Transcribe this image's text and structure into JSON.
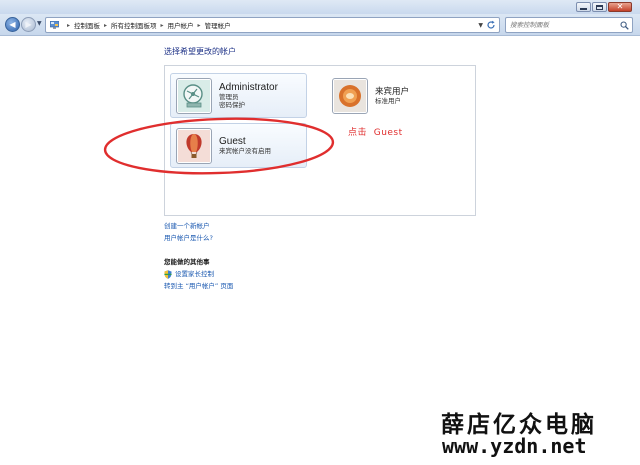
{
  "window": {
    "controls": [
      "minimize",
      "maximize",
      "close"
    ]
  },
  "toolbar": {
    "breadcrumbs": [
      "控制面板",
      "所有控制面板项",
      "用户帐户",
      "管理帐户"
    ],
    "search_placeholder": "搜索控制面板"
  },
  "main": {
    "title": "选择希望更改的帐户",
    "accounts": [
      {
        "name": "Administrator",
        "lines": [
          "管理员",
          "密码保护"
        ],
        "icon": "network-icon"
      },
      {
        "name": "来宾用户",
        "lines": [
          "标准用户"
        ],
        "icon": "orange-flower-icon"
      },
      {
        "name": "Guest",
        "lines": [
          "来宾帐户没有启用"
        ],
        "icon": "hot-air-balloon-icon"
      }
    ],
    "annotation": "点击  Guest",
    "annotation_color": "#e02e2e",
    "links": [
      "创建一个新帐户",
      "用户帐户是什么?"
    ],
    "other_section_title": "您能做的其他事",
    "other_links": [
      "设置家长控制",
      "转到主 “用户帐户” 页面"
    ]
  },
  "watermark": {
    "chinese": "薛店亿众电脑",
    "url": "www.yzdn.net"
  },
  "colors": {
    "link": "#1a58b0",
    "title": "#1e3287",
    "annotation": "#e02e2e"
  }
}
